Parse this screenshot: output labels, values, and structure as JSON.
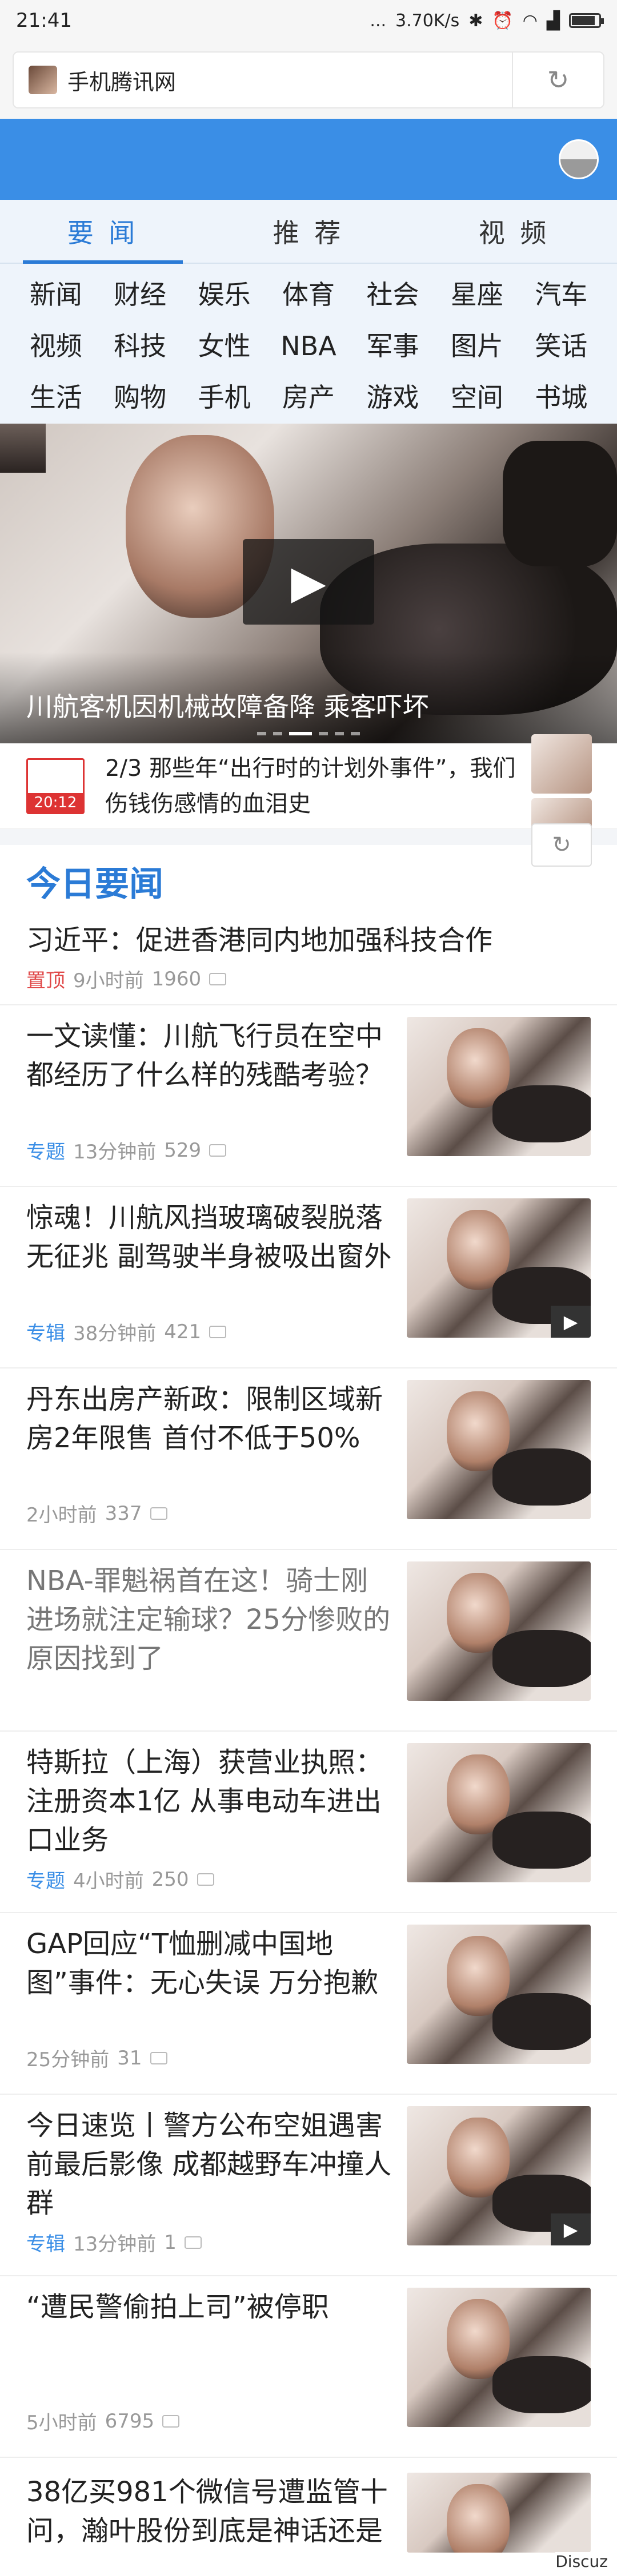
{
  "status": {
    "time": "21:41",
    "dots": "...",
    "speed": "3.70K/s",
    "icons": [
      "bluetooth-icon",
      "alarm-icon",
      "wifi-icon",
      "signal-icon",
      "battery-icon"
    ],
    "battery_level": 0.8
  },
  "address_bar": {
    "site_name": "手机腾讯网",
    "refresh_icon": "↻"
  },
  "main_tabs": [
    {
      "label": "要 闻",
      "active": true
    },
    {
      "label": "推 荐",
      "active": false
    },
    {
      "label": "视 频",
      "active": false
    }
  ],
  "channels": [
    "新闻",
    "财经",
    "娱乐",
    "体育",
    "社会",
    "星座",
    "汽车",
    "视频",
    "科技",
    "女性",
    "NBA",
    "军事",
    "图片",
    "笑话",
    "生活",
    "购物",
    "手机",
    "房产",
    "游戏",
    "空间",
    "书城"
  ],
  "hero": {
    "caption": "川航客机因机械故障备降 乘客吓坏",
    "play_icon": "▶"
  },
  "scroll_news": {
    "badge_time": "20:12",
    "text": "2/3  那些年“出行时的计划外事件”，我们伤钱伤感情的血泪史",
    "refresh_icon": "↻"
  },
  "section_title": "今日要闻",
  "top_news": {
    "title": "习近平：促进香港同内地加强科技合作",
    "pin": "置顶",
    "time": "9小时前",
    "comments": "1960"
  },
  "news": [
    {
      "title": "一文读懂：川航飞行员在空中都经历了什么样的残酷考验？",
      "tag": "专题",
      "time": "13分钟前",
      "comments": "529",
      "video": false,
      "gray": false
    },
    {
      "title": "惊魂！川航风挡玻璃破裂脱落无征兆 副驾驶半身被吸出窗外",
      "tag": "专辑",
      "time": "38分钟前",
      "comments": "421",
      "video": true,
      "gray": false
    },
    {
      "title": "丹东出房产新政：限制区域新房2年限售 首付不低于50%",
      "tag": "",
      "time": "2小时前",
      "comments": "337",
      "video": false,
      "gray": false
    },
    {
      "title": "NBA-罪魁祸首在这！骑士刚进场就注定输球？25分惨败的原因找到了",
      "tag": "",
      "time": "",
      "comments": "",
      "video": false,
      "gray": true
    },
    {
      "title": "特斯拉（上海）获营业执照：注册资本1亿 从事电动车进出口业务",
      "tag": "专题",
      "time": "4小时前",
      "comments": "250",
      "video": false,
      "gray": false
    },
    {
      "title": "GAP回应“T恤删减中国地图”事件：无心失误 万分抱歉",
      "tag": "",
      "time": "25分钟前",
      "comments": "31",
      "video": false,
      "gray": false
    },
    {
      "title": "今日速览丨警方公布空姐遇害前最后影像 成都越野车冲撞人群",
      "tag": "专辑",
      "time": "13分钟前",
      "comments": "1",
      "video": true,
      "gray": false
    },
    {
      "title": "“遭民警偷拍上司”被停职",
      "tag": "",
      "time": "5小时前",
      "comments": "6795",
      "video": false,
      "gray": false
    }
  ],
  "last_news": {
    "title": "38亿买981个微信号遭监管十问，瀚叶股份到底是神话还是"
  },
  "footer_tag": "Discuz"
}
